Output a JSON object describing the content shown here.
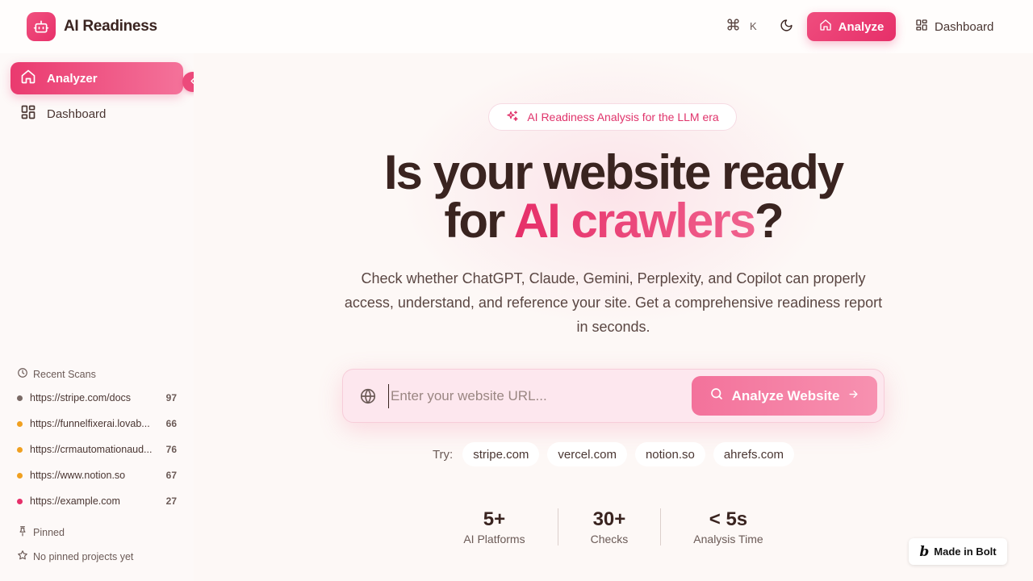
{
  "app": {
    "name": "AI Readiness"
  },
  "header": {
    "shortcut_key": "K",
    "nav": [
      {
        "label": "Analyze",
        "icon": "home-icon",
        "active": true
      },
      {
        "label": "Dashboard",
        "icon": "grid-icon",
        "active": false
      }
    ]
  },
  "sidebar": {
    "items": [
      {
        "label": "Analyzer",
        "icon": "home-icon",
        "active": true
      },
      {
        "label": "Dashboard",
        "icon": "grid-icon",
        "active": false
      }
    ],
    "recent_title": "Recent Scans",
    "recent_scans": [
      {
        "url": "https://stripe.com/docs",
        "score": "97",
        "color": "#7a6a66"
      },
      {
        "url": "https://funnelfixerai.lovab...",
        "score": "66",
        "color": "#f0a020"
      },
      {
        "url": "https://crmautomationaud...",
        "score": "76",
        "color": "#f0a020"
      },
      {
        "url": "https://www.notion.so",
        "score": "67",
        "color": "#f0a020"
      },
      {
        "url": "https://example.com",
        "score": "27",
        "color": "#e6306a"
      }
    ],
    "pinned_title": "Pinned",
    "pinned_empty": "No pinned projects yet"
  },
  "hero": {
    "pill": "AI Readiness Analysis for the LLM era",
    "headline_line1": "Is your website ready",
    "headline_line2_pre": "for ",
    "headline_line2_accent": "AI crawlers",
    "headline_line2_post": "?",
    "subtext": "Check whether ChatGPT, Claude, Gemini, Perplexity, and Copilot can properly access, understand, and reference your site. Get a comprehensive readiness report in seconds."
  },
  "search": {
    "placeholder": "Enter your website URL...",
    "value": "",
    "button_label": "Analyze Website"
  },
  "try": {
    "label": "Try:",
    "examples": [
      "stripe.com",
      "vercel.com",
      "notion.so",
      "ahrefs.com"
    ]
  },
  "stats": [
    {
      "value": "5+",
      "label": "AI Platforms"
    },
    {
      "value": "30+",
      "label": "Checks"
    },
    {
      "value": "< 5s",
      "label": "Analysis Time"
    }
  ],
  "badge": {
    "mark": "b",
    "label": "Made in Bolt"
  },
  "colors": {
    "accent": "#e62f69",
    "accent_light": "#f4729a"
  }
}
